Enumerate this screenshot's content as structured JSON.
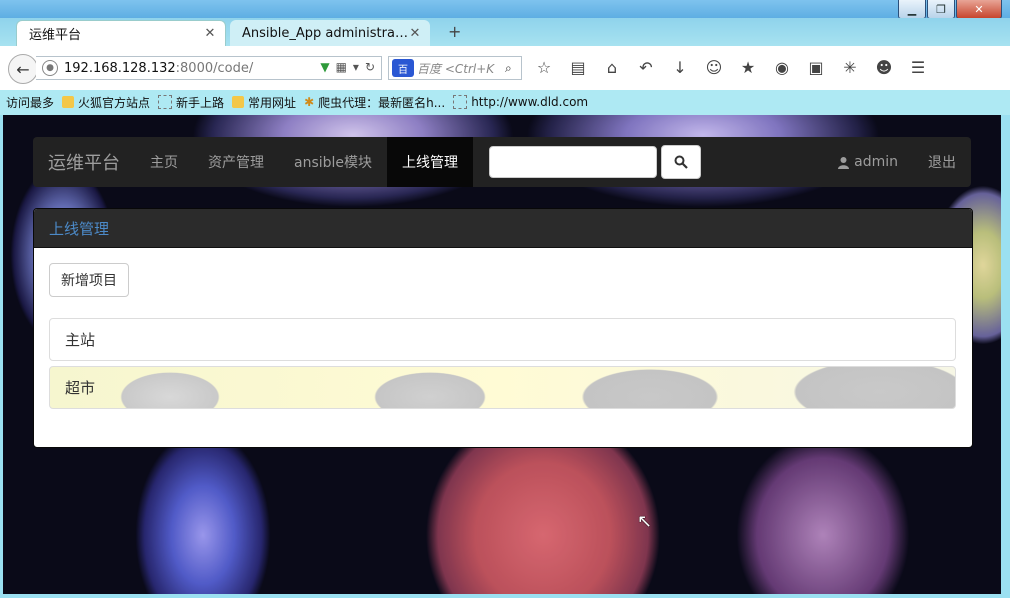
{
  "browser": {
    "tabs": [
      {
        "title": "运维平台",
        "active": true
      },
      {
        "title": "Ansible_App administration ...",
        "active": false
      }
    ],
    "tab_close": "✕",
    "new_tab": "+",
    "url_host": "192.168.128.132",
    "url_path": ":8000/code/",
    "search_placeholder": "百度 <Ctrl+K",
    "search_engine": "百",
    "bookmarks": [
      "访问最多",
      "火狐官方站点",
      "新手上路",
      "常用网址",
      "爬虫代理：最新匿名h...",
      "http://www.dld.com"
    ],
    "window_buttons": [
      "▁",
      "❐",
      "✕"
    ]
  },
  "site": {
    "brand": "运维平台",
    "nav": [
      "主页",
      "资产管理",
      "ansible模块",
      "上线管理"
    ],
    "active_nav": "上线管理",
    "search_value": "",
    "user": "admin",
    "logout": "退出"
  },
  "panel": {
    "heading": "上线管理",
    "add_button": "新增项目",
    "projects": [
      "主站",
      "超市"
    ]
  },
  "colors": {
    "navbar_bg": "#222222",
    "panel_heading_text": "#4c8ac8",
    "active_nav_bg": "#080808"
  }
}
